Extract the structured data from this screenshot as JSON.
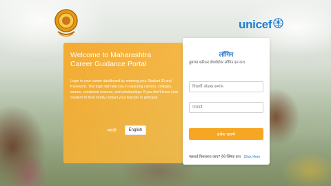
{
  "header": {
    "left_emblem_icon": "maharashtra-govt-emblem-icon",
    "right_logo_text": "unicef",
    "right_logo_icon": "unicef-globe-icon",
    "brand_color": "#1f7fd0"
  },
  "welcome": {
    "title": "Welcome to Maharashtra Career Guidance Portal",
    "description": "Login to your career dashboard by entering your Student ID and Password. This login will help you in exploring careers, colleges, exams, vocational courses, and scholarships. If you don't know your Student ID then kindly contact your teacher or principal.",
    "languages": [
      "मराठी",
      "English"
    ],
    "accent_color": "#f5a623"
  },
  "login": {
    "title": "लॉगिन",
    "subtitle": "तुमच्या करिअर डॅशबोर्डवर लॉगिन इन करा",
    "username_placeholder": "विद्यार्थी ओळख क्रमांक",
    "password_placeholder": "पासवर्ड",
    "submit_label": "प्रवेश करणे",
    "forgot_text": "पासवर्ड विसरलाय काय? येथे क्लिक करा",
    "forgot_link": "Click Here",
    "link_color": "#2b7ac6"
  }
}
